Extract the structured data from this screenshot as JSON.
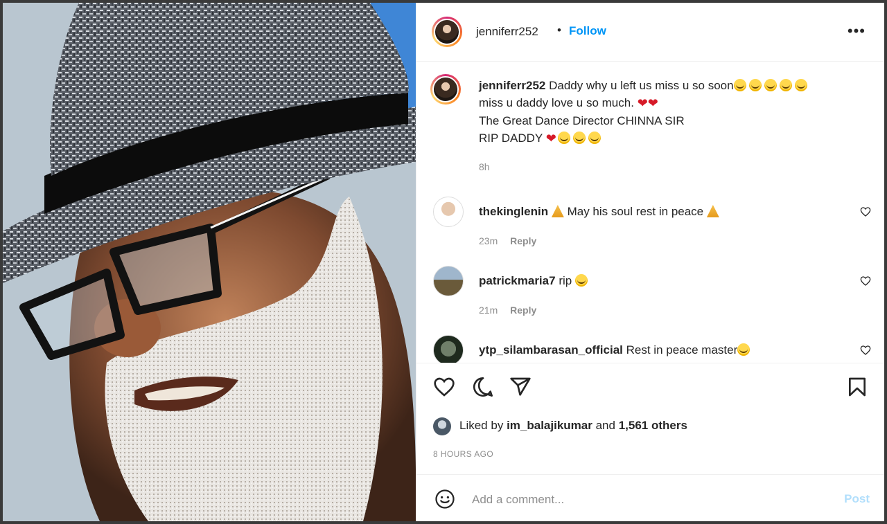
{
  "post": {
    "username": "jenniferr252",
    "separator": "•",
    "follow_label": "Follow",
    "more_icon": "•••"
  },
  "caption": {
    "username": "jenniferr252",
    "line1": "Daddy why u left us miss u so soon",
    "line2": "miss u daddy love u so much.",
    "line3": "The Great Dance Director CHINNA SIR",
    "line4": "RIP DADDY",
    "time": "8h"
  },
  "comments": [
    {
      "username": "thekinglenin",
      "text": "May his soul rest in peace",
      "time": "23m",
      "reply": "Reply"
    },
    {
      "username": "patrickmaria7",
      "text": "rip",
      "time": "21m",
      "reply": "Reply"
    },
    {
      "username": "ytp_silambarasan_official",
      "text": "Rest in peace master",
      "time": "",
      "reply": ""
    }
  ],
  "likes": {
    "prefix": "Liked by",
    "user": "im_balajikumar",
    "and": "and",
    "count": "1,561 others"
  },
  "timestamp": "8 HOURS AGO",
  "add_comment": {
    "placeholder": "Add a comment...",
    "post_label": "Post"
  },
  "colors": {
    "follow": "#0095f6",
    "post_disabled": "#b2dffc",
    "heart": "#d61a28",
    "muted": "#8e8e8e"
  }
}
